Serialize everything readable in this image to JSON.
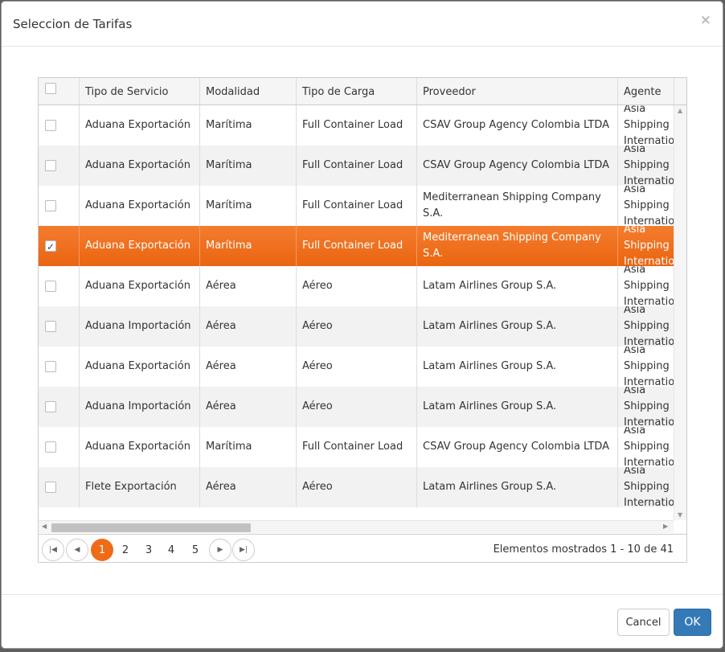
{
  "dialog": {
    "title": "Seleccion de Tarifas",
    "close": "×"
  },
  "grid": {
    "columns": [
      "Tipo de Servicio",
      "Modalidad",
      "Tipo de Carga",
      "Proveedor",
      "Agente"
    ],
    "rows": [
      {
        "checked": false,
        "servicio": "Aduana Exportación",
        "modalidad": "Marítima",
        "carga": "Full Container Load",
        "proveedor": "CSAV Group Agency Colombia LTDA",
        "agente": "Asia Shipping International"
      },
      {
        "checked": false,
        "servicio": "Aduana Exportación",
        "modalidad": "Marítima",
        "carga": "Full Container Load",
        "proveedor": "CSAV Group Agency Colombia LTDA",
        "agente": "Asia Shipping International"
      },
      {
        "checked": false,
        "servicio": "Aduana Exportación",
        "modalidad": "Marítima",
        "carga": "Full Container Load",
        "proveedor": "Mediterranean Shipping Company S.A.",
        "agente": "Asia Shipping International"
      },
      {
        "checked": true,
        "servicio": "Aduana Exportación",
        "modalidad": "Marítima",
        "carga": "Full Container Load",
        "proveedor": "Mediterranean Shipping Company S.A.",
        "agente": "Asia Shipping International"
      },
      {
        "checked": false,
        "servicio": "Aduana Exportación",
        "modalidad": "Aérea",
        "carga": "Aéreo",
        "proveedor": "Latam Airlines Group S.A.",
        "agente": "Asia Shipping International"
      },
      {
        "checked": false,
        "servicio": "Aduana Importación",
        "modalidad": "Aérea",
        "carga": "Aéreo",
        "proveedor": "Latam Airlines Group S.A.",
        "agente": "Asia Shipping International"
      },
      {
        "checked": false,
        "servicio": "Aduana Exportación",
        "modalidad": "Aérea",
        "carga": "Aéreo",
        "proveedor": "Latam Airlines Group S.A.",
        "agente": "Asia Shipping International"
      },
      {
        "checked": false,
        "servicio": "Aduana Importación",
        "modalidad": "Aérea",
        "carga": "Aéreo",
        "proveedor": "Latam Airlines Group S.A.",
        "agente": "Asia Shipping International"
      },
      {
        "checked": false,
        "servicio": "Aduana Exportación",
        "modalidad": "Marítima",
        "carga": "Full Container Load",
        "proveedor": "CSAV Group Agency Colombia LTDA",
        "agente": "Asia Shipping International"
      },
      {
        "checked": false,
        "servicio": "Flete Exportación",
        "modalidad": "Aérea",
        "carga": "Aéreo",
        "proveedor": "Latam Airlines Group S.A.",
        "agente": "Asia Shipping International"
      }
    ]
  },
  "pager": {
    "pages": [
      "1",
      "2",
      "3",
      "4",
      "5"
    ],
    "current_page": "1",
    "info": "Elementos mostrados 1 - 10 de 41"
  },
  "footer": {
    "cancel_label": "Cancel",
    "ok_label": "OK"
  },
  "colors": {
    "selected_row": "#ef6b18",
    "primary_button": "#337ab7"
  },
  "icons": {
    "first": "first-page-icon",
    "prev": "previous-page-icon",
    "next": "next-page-icon",
    "last": "last-page-icon"
  }
}
